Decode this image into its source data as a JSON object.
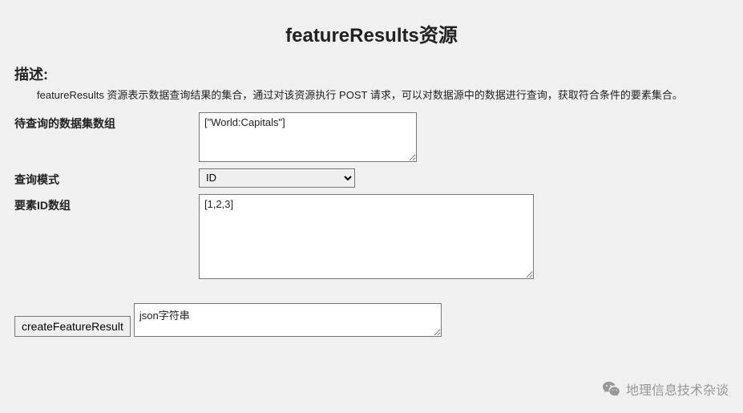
{
  "title": "featureResults资源",
  "description": {
    "label": "描述:",
    "text": "featureResults 资源表示数据查询结果的集合，通过对该资源执行 POST 请求，可以对数据源中的数据进行查询，获取符合条件的要素集合。"
  },
  "form": {
    "datasets": {
      "label": "待查询的数据集数组",
      "value": "[\"World:Capitals\"]"
    },
    "queryMode": {
      "label": "查询模式",
      "selected": "ID",
      "options": [
        "ID"
      ]
    },
    "ids": {
      "label": "要素ID数组",
      "value": "[1,2,3]"
    },
    "submit": {
      "button": "createFeatureResult",
      "jsonValue": "json字符串"
    }
  },
  "watermark": {
    "text": "地理信息技术杂谈"
  }
}
